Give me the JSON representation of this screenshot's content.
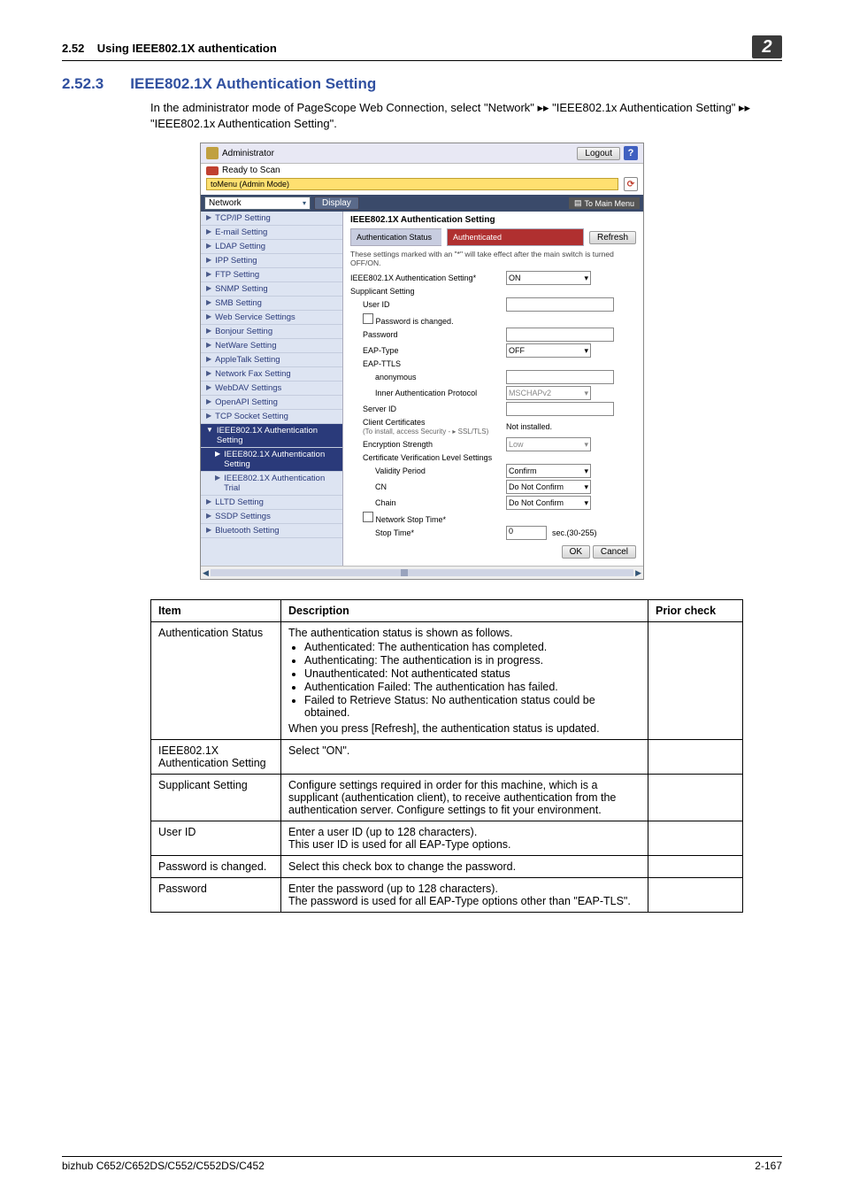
{
  "header": {
    "section_label": "2.52",
    "section_title": "Using IEEE802.1X authentication",
    "chapter_number": "2"
  },
  "section": {
    "number": "2.52.3",
    "title": "IEEE802.1X Authentication Setting",
    "intro": "In the administrator mode of PageScope Web Connection, select \"Network\" ▸▸ \"IEEE802.1x Authentication Setting\" ▸▸ \"IEEE802.1x Authentication Setting\"."
  },
  "screenshot": {
    "top": {
      "user_label": "Administrator",
      "logout_btn": "Logout",
      "help_badge": "?",
      "ready_text": "Ready to Scan",
      "mode_text": "toMenu (Admin Mode)",
      "refresh_icon": "⟳"
    },
    "bar": {
      "category_value": "Network",
      "display_btn": "Display",
      "mainmenu_btn": "To Main Menu"
    },
    "sidenav": [
      "TCP/IP Setting",
      "E-mail Setting",
      "LDAP Setting",
      "IPP Setting",
      "FTP Setting",
      "SNMP Setting",
      "SMB Setting",
      "Web Service Settings",
      "Bonjour Setting",
      "NetWare Setting",
      "AppleTalk Setting",
      "Network Fax Setting",
      "WebDAV Settings",
      "OpenAPI Setting",
      "TCP Socket Setting",
      "IEEE802.1X Authentication Setting",
      "IEEE802.1X Authentication Setting",
      "IEEE802.1X Authentication Trial",
      "LLTD Setting",
      "SSDP Settings",
      "Bluetooth Setting"
    ],
    "content": {
      "heading": "IEEE802.1X Authentication Setting",
      "status_label": "Authentication Status",
      "status_value": "Authenticated",
      "refresh_btn": "Refresh",
      "note": "These settings marked with an \"*\" will take effect after the main switch is turned OFF/ON.",
      "rows": {
        "auth_setting_lbl": "IEEE802.1X Authentication Setting*",
        "auth_setting_val": "ON",
        "supplicant_lbl": "Supplicant Setting",
        "user_id_lbl": "User ID",
        "pwd_changed_lbl": "Password is changed.",
        "password_lbl": "Password",
        "eap_type_lbl": "EAP-Type",
        "eap_type_val": "OFF",
        "eap_ttls_lbl": "EAP-TTLS",
        "anonymous_lbl": "anonymous",
        "inner_auth_lbl": "Inner Authentication Protocol",
        "inner_auth_val": "MSCHAPv2",
        "server_id_lbl": "Server ID",
        "client_cert_lbl": "Client Certificates",
        "client_cert_note": "(To install, access Security - ▸ SSL/TLS)",
        "client_cert_val": "Not installed.",
        "enc_strength_lbl": "Encryption Strength",
        "enc_strength_val": "Low",
        "cert_verify_lbl": "Certificate Verification Level Settings",
        "validity_lbl": "Validity Period",
        "validity_val": "Confirm",
        "cn_lbl": "CN",
        "cn_val": "Do Not Confirm",
        "chain_lbl": "Chain",
        "chain_val": "Do Not Confirm",
        "net_stop_lbl": "Network Stop Time*",
        "stop_time_lbl": "Stop Time*",
        "stop_time_val": "0",
        "stop_time_unit": "sec.(30-255)"
      },
      "ok_btn": "OK",
      "cancel_btn": "Cancel"
    }
  },
  "table": {
    "headers": {
      "item": "Item",
      "desc": "Description",
      "prior": "Prior check"
    },
    "rows": [
      {
        "item": "Authentication Status",
        "desc_pre": "The authentication status is shown as follows.",
        "bullets": [
          "Authenticated: The authentication has completed.",
          "Authenticating: The authentication is in progress.",
          "Unauthenticated: Not authenticated status",
          "Authentication Failed: The authentication has failed.",
          "Failed to Retrieve Status: No authentication status could be obtained."
        ],
        "desc_post": "When you press [Refresh], the authentication status is updated.",
        "prior": ""
      },
      {
        "item": "IEEE802.1X Authentication Setting",
        "desc": "Select \"ON\".",
        "prior": ""
      },
      {
        "item": "Supplicant Setting",
        "desc": "Configure settings required in order for this machine, which is a supplicant (authentication client), to receive authentication from the authentication server. Configure settings to fit your environment.",
        "prior": ""
      },
      {
        "item": "User ID",
        "desc": "Enter a user ID (up to 128 characters).\nThis user ID is used for all EAP-Type options.",
        "prior": ""
      },
      {
        "item": "Password is changed.",
        "desc": "Select this check box to change the password.",
        "prior": ""
      },
      {
        "item": "Password",
        "desc": "Enter the password (up to 128 characters).\nThe password is used for all EAP-Type options other than \"EAP-TLS\".",
        "prior": ""
      }
    ]
  },
  "footer": {
    "product": "bizhub C652/C652DS/C552/C552DS/C452",
    "pagenum": "2-167"
  }
}
